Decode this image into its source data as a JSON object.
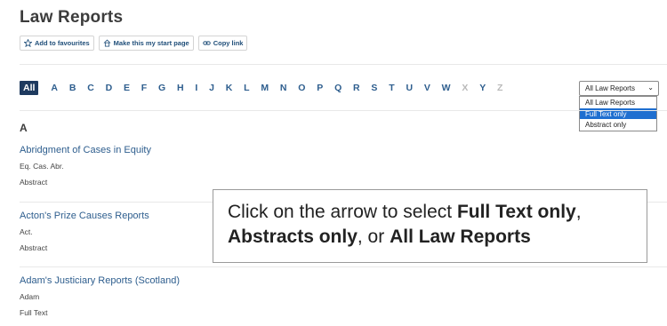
{
  "page": {
    "title": "Law Reports"
  },
  "actions": [
    {
      "label": "Add to favourites",
      "icon": "star-icon"
    },
    {
      "label": "Make this my start page",
      "icon": "home-icon"
    },
    {
      "label": "Copy link",
      "icon": "link-icon"
    }
  ],
  "alphabet": {
    "all_label": "All",
    "letters": [
      "A",
      "B",
      "C",
      "D",
      "E",
      "F",
      "G",
      "H",
      "I",
      "J",
      "K",
      "L",
      "M",
      "N",
      "O",
      "P",
      "Q",
      "R",
      "S",
      "T",
      "U",
      "V",
      "W",
      "X",
      "Y",
      "Z"
    ],
    "disabled": [
      "X",
      "Z"
    ]
  },
  "filter": {
    "selected": "All Law Reports",
    "options": [
      "All Law Reports",
      "Full Text only",
      "Abstract only"
    ],
    "highlighted": "Full Text only"
  },
  "section_letter": "A",
  "entries": [
    {
      "title": "Abridgment of Cases in Equity",
      "abbr": "Eq. Cas. Abr.",
      "type": "Abstract"
    },
    {
      "title": "Acton's Prize Causes Reports",
      "abbr": "Act.",
      "type": "Abstract"
    },
    {
      "title": "Adam's Justiciary Reports (Scotland)",
      "abbr": "Adam",
      "type": "Full Text"
    }
  ],
  "callout": {
    "part1": "Click on the arrow to select ",
    "bold1": "Full Text only",
    "part2": ",",
    "bold2": "Abstracts only",
    "part3": ", or ",
    "bold3": "All Law Reports"
  },
  "colors": {
    "link": "#2e5e8e",
    "all_bg": "#1e3a5f",
    "highlight": "#1f6fd0"
  }
}
